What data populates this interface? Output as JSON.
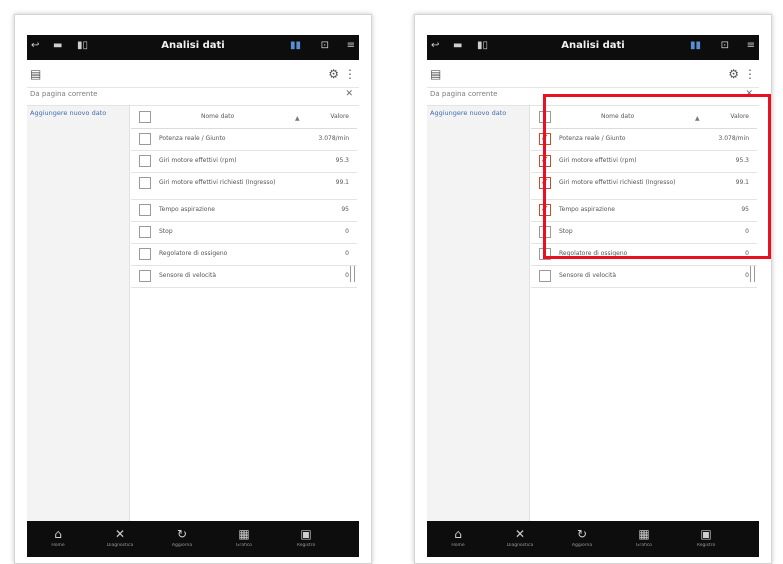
{
  "app": {
    "title": "Analisi dati",
    "search_label": "Da pagina corrente",
    "sidebar_link": "Aggiungere nuovo dato",
    "col_name": "Nome dato",
    "col_value": "Valore",
    "sort_glyph": "▲",
    "close_glyph": "✕",
    "check_glyph": "✓"
  },
  "rows": [
    {
      "name": "Potenza reale / Giunto",
      "value": "3.078/min"
    },
    {
      "name": "Giri motore effettivi (rpm)",
      "value": "95.3"
    },
    {
      "name": "Giri motore effettivi richiesti (Ingresso)",
      "value": "99.1"
    },
    {
      "name": "Tempo aspirazione",
      "value": "95"
    },
    {
      "name": "Stop",
      "value": "0"
    },
    {
      "name": "Regolatore di ossigeno",
      "value": "0"
    },
    {
      "name": "Sensore di velocità",
      "value": "0"
    }
  ],
  "right_checked": [
    true,
    true,
    true,
    true,
    false,
    false,
    false
  ],
  "bottom_nav": [
    {
      "icon": "home-icon",
      "glyph": "⌂",
      "label": "Home"
    },
    {
      "icon": "diagnostics-icon",
      "glyph": "✕",
      "label": "Diagnostica"
    },
    {
      "icon": "refresh-icon",
      "glyph": "↻",
      "label": "Aggiorna"
    },
    {
      "icon": "graph-icon",
      "glyph": "▦",
      "label": "Grafico"
    },
    {
      "icon": "calendar-icon",
      "glyph": "▣",
      "label": "Registro"
    }
  ],
  "colors": {
    "bar_bg": "#0d0d0d",
    "highlight": "#e81022",
    "link": "#3c6db0",
    "check": "#c14d2c"
  }
}
